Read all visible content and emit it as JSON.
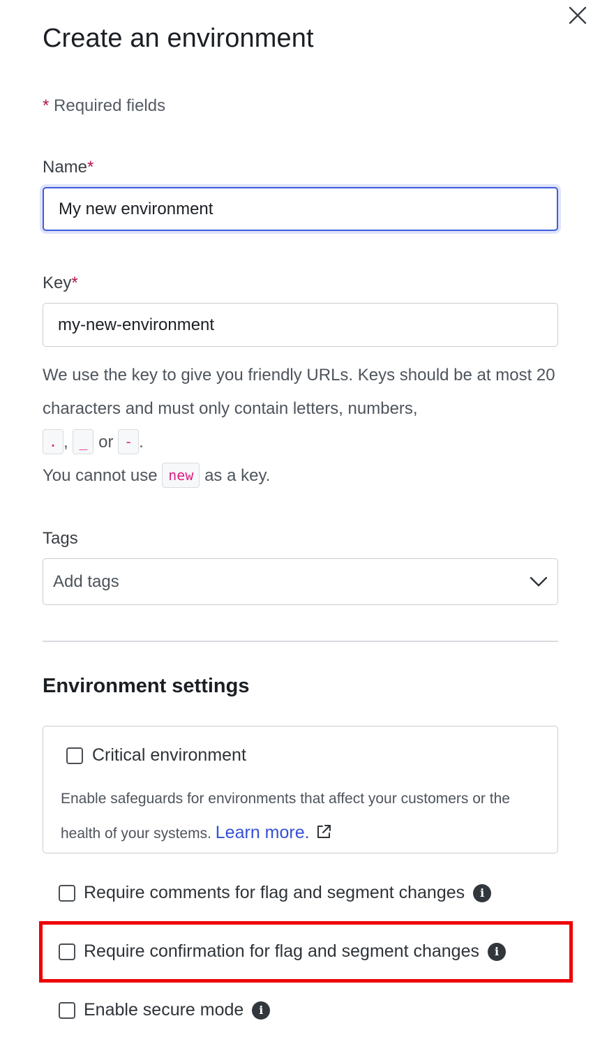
{
  "dialog": {
    "title": "Create an environment",
    "close_label": "×"
  },
  "form": {
    "required_asterisk": "*",
    "required_note": "Required fields",
    "name": {
      "label": "Name",
      "value": "My new environment"
    },
    "key": {
      "label": "Key",
      "value": "my-new-environment",
      "help_text": "We use the key to give you friendly URLs. Keys should be at most 20 characters and must only contain letters, numbers,",
      "chip_dot": ".",
      "comma": ",",
      "chip_underscore": "_",
      "or_word": "or",
      "chip_dash": "-",
      "period": ".",
      "cannot_prefix": "You cannot use",
      "chip_new": "new",
      "cannot_suffix": "as a key."
    },
    "tags": {
      "label": "Tags",
      "placeholder": "Add tags"
    }
  },
  "settings": {
    "title": "Environment settings",
    "critical": {
      "label": "Critical environment",
      "description": "Enable safeguards for environments that affect your customers or the health of your systems.",
      "link_text": "Learn more."
    },
    "options": [
      {
        "label": "Require comments for flag and segment changes"
      },
      {
        "label": "Require confirmation for flag and segment changes"
      },
      {
        "label": "Enable secure mode"
      }
    ]
  },
  "colors": {
    "accent": "#405bdc",
    "required": "#b3164b",
    "link": "#3650d4",
    "highlight": "#ef0000",
    "code": "#dd1f86"
  }
}
